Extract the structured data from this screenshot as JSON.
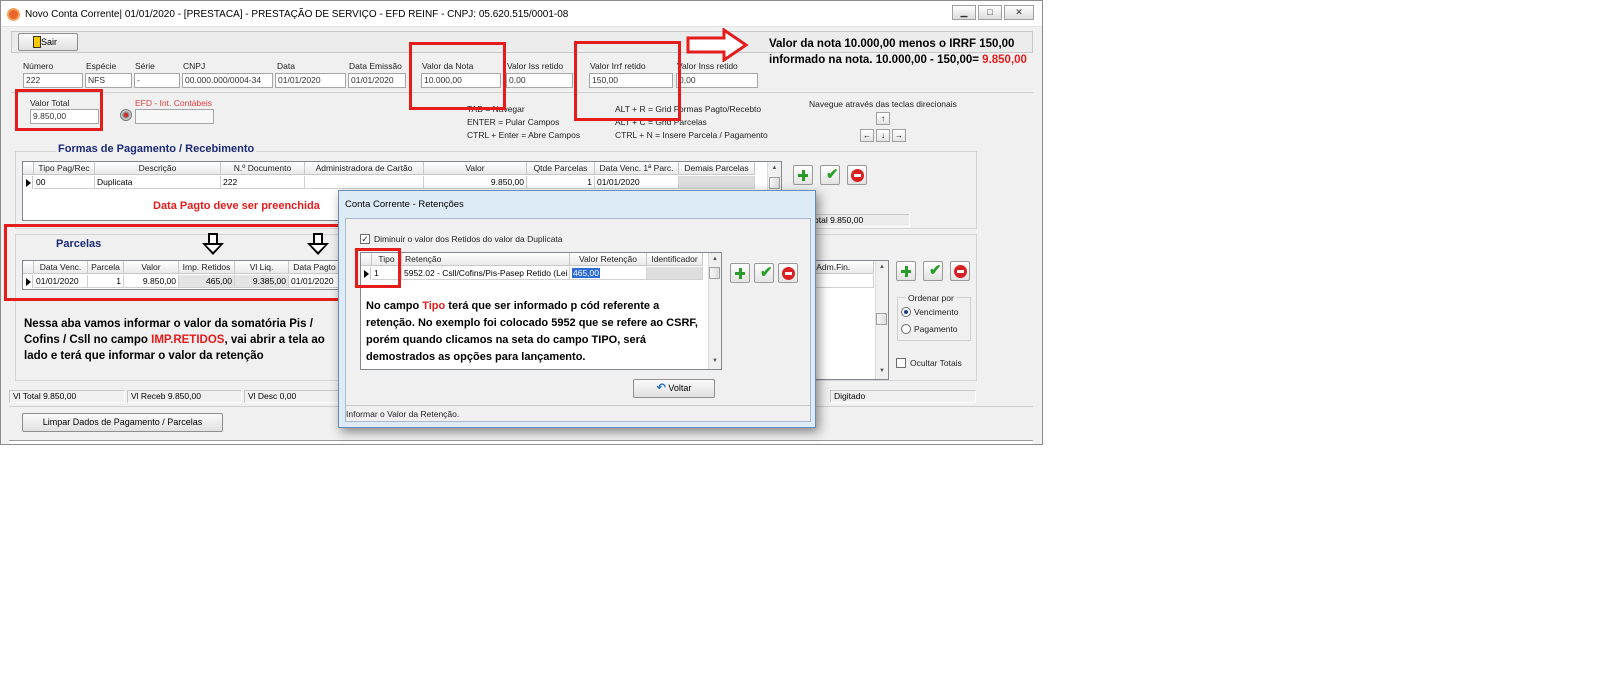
{
  "window": {
    "title": "Novo Conta Corrente|  01/01/2020 - [PRESTACA] - PRESTAÇÃO DE SERVIÇO - EFD REINF - CNPJ: 05.620.515/0001-08",
    "minimize": "▁",
    "maximize": "□",
    "close": "✕"
  },
  "toolbar": {
    "sair": "Sair"
  },
  "header_fields": {
    "numero": {
      "label": "Número",
      "value": "222"
    },
    "especie": {
      "label": "Espécie",
      "value": "NFS"
    },
    "serie": {
      "label": "Série",
      "value": "-"
    },
    "cnpj": {
      "label": "CNPJ",
      "value": "00.000.000/0004-34"
    },
    "data": {
      "label": "Data",
      "value": "01/01/2020"
    },
    "data_emissao": {
      "label": "Data Emissão",
      "value": "01/01/2020"
    },
    "valor_nota": {
      "label": "Valor da Nota",
      "value": "10.000,00"
    },
    "valor_iss": {
      "label": "Valor Iss retido",
      "value": "0,00"
    },
    "valor_irrf": {
      "label": "Valor Irrf retido",
      "value": "150,00"
    },
    "valor_inss": {
      "label": "Valor Inss retido",
      "value": "0,00"
    }
  },
  "valor_total": {
    "label": "Valor Total",
    "value": "9.850,00"
  },
  "efd": {
    "label": "EFD - Int. Contábeis"
  },
  "shortcuts": {
    "tab": "TAB = Navegar",
    "enter": "ENTER = Pular Campos",
    "ctrl_enter": "CTRL + Enter = Abre Campos",
    "alt_r": "ALT + R = Grid Formas Pagto/Recebto",
    "alt_c": "ALT + C = Grid Parcelas",
    "ctrl_n": "CTRL + N = Insere Parcela / Pagamento",
    "navegue": "Navegue através das teclas direcionais",
    "up": "↑",
    "left": "←",
    "down": "↓",
    "right": "→"
  },
  "formas": {
    "title": "Formas de Pagamento / Recebimento",
    "columns": [
      "Tipo Pag/Rec",
      "Descrição",
      "N.º Documento",
      "Administradora de Cartão",
      "Valor",
      "Qtde Parcelas",
      "Data Venc. 1ª Parc.",
      "Demais Parcelas"
    ],
    "row": [
      "00",
      "Duplicata",
      "222",
      "",
      "9.850,00",
      "1",
      "01/01/2020",
      ""
    ]
  },
  "total_formas": "Vl Total  9.850,00",
  "data_pagto_msg": "Data Pagto deve ser preenchida",
  "parcelas": {
    "title": "Parcelas",
    "columns": [
      "Data Venc.",
      "Parcela",
      "Valor",
      "Imp. Retidos",
      "Vl Liq.",
      "Data Pagto"
    ],
    "row": [
      "01/01/2020",
      "1",
      "9.850,00",
      "465,00",
      "9.385,00",
      "01/01/2020"
    ]
  },
  "adm_fin_col": "/ Adm.Fin.",
  "ordenar": {
    "label": "Ordenar por",
    "vencimento": "Vencimento",
    "pagamento": "Pagamento"
  },
  "ocultar_totais": "Ocultar Totais",
  "status_bar": {
    "vl_total": "Vl Total  9.850,00",
    "vl_receb": "Vl Receb  9.850,00",
    "vl_desc": "Vl Desc  0,00",
    "digitado": "Digitado"
  },
  "limpar_button": "Limpar Dados de Pagamento / Parcelas",
  "dialog": {
    "title": "Conta Corrente - Retenções",
    "checkbox_label": "Diminuir o valor dos Retidos do valor da Duplicata",
    "checkbox_mark": "✓",
    "columns": [
      "Tipo",
      "Retenção",
      "Valor Retenção",
      "Identificador"
    ],
    "row": [
      "1",
      "5952.02 - Csll/Cofins/Pis-Pasep Retido (Lei",
      "465,00",
      ""
    ],
    "note_p1": "No campo ",
    "note_tipo": "Tipo",
    "note_p2": " terá que ser informado p cód referente a retenção. No exemplo foi colocado 5952 que se refere ao CSRF, porém quando clicamos na seta do campo TIPO, será demostrados as opções para lançamento.",
    "voltar": "Voltar",
    "status": "Informar o Valor da Retenção."
  },
  "annotations": {
    "top_right_1": "Valor da nota 10.000,00 menos o IRRF 150,00",
    "top_right_2": "informado na nota. 10.000,00 - 150,00=",
    "top_right_result": "9.850,00",
    "left_p1": "Nessa aba vamos informar o valor da somatória Pis / Cofins / Csll no campo  ",
    "left_highlight": "IMP.RETIDOS",
    "left_p2": ", vai abrir a tela ao lado e terá que informar o valor da retenção"
  },
  "colors": {
    "annotation_red": "#e41c1c",
    "section_title": "#1c2a78",
    "dialog_frame": "#ddebf7"
  }
}
